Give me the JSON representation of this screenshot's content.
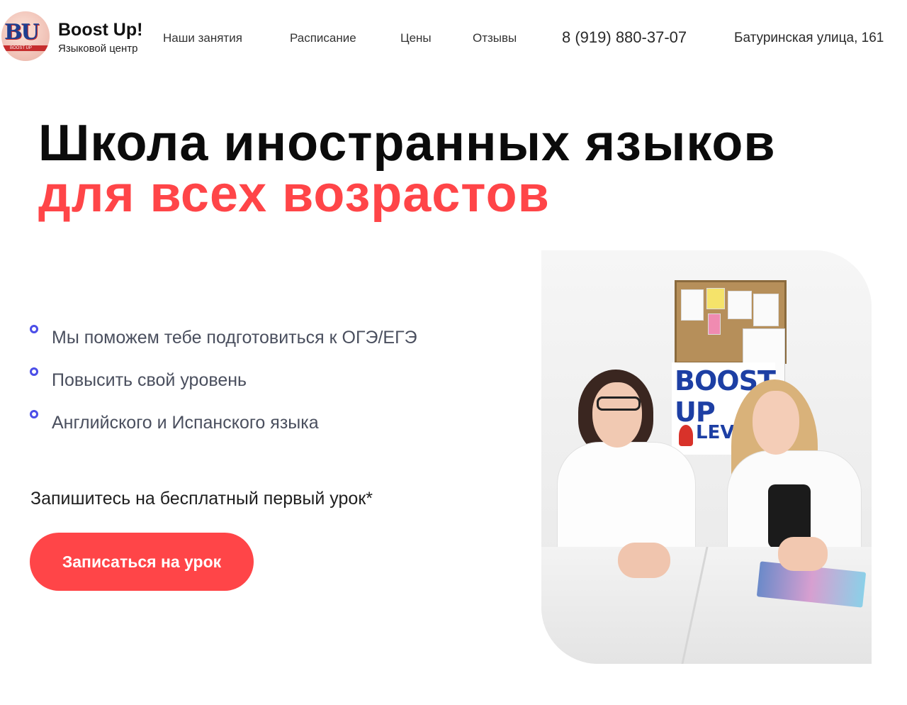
{
  "brand": {
    "logo_text": "BU",
    "logo_subtext": "BOOST UP",
    "title": "Boost Up!",
    "subtitle": "Языковой центр"
  },
  "nav": {
    "items": [
      {
        "label": "Наши занятия"
      },
      {
        "label": "Расписание"
      },
      {
        "label": "Цены"
      },
      {
        "label": "Отзывы"
      }
    ],
    "phone": "8 (919) 880-37-07",
    "address": "Батуринская улица, 161"
  },
  "hero": {
    "title_line1": "Школа иностранных языков",
    "title_line2": "для всех возрастов",
    "features": [
      "Мы поможем тебе подготовиться к ОГЭ/ЕГЭ",
      "Повысить свой уровень",
      "Английского и Испанского языка"
    ],
    "cta_text": "Запишитесь на бесплатный первый урок*",
    "cta_button": "Записаться на урок"
  },
  "photo": {
    "poster_text": "BOOST UP",
    "poster_level": "LEVEL"
  },
  "colors": {
    "accent": "#ff4548",
    "bullet": "#4b4ee8",
    "heading": "#0b0b0b"
  }
}
